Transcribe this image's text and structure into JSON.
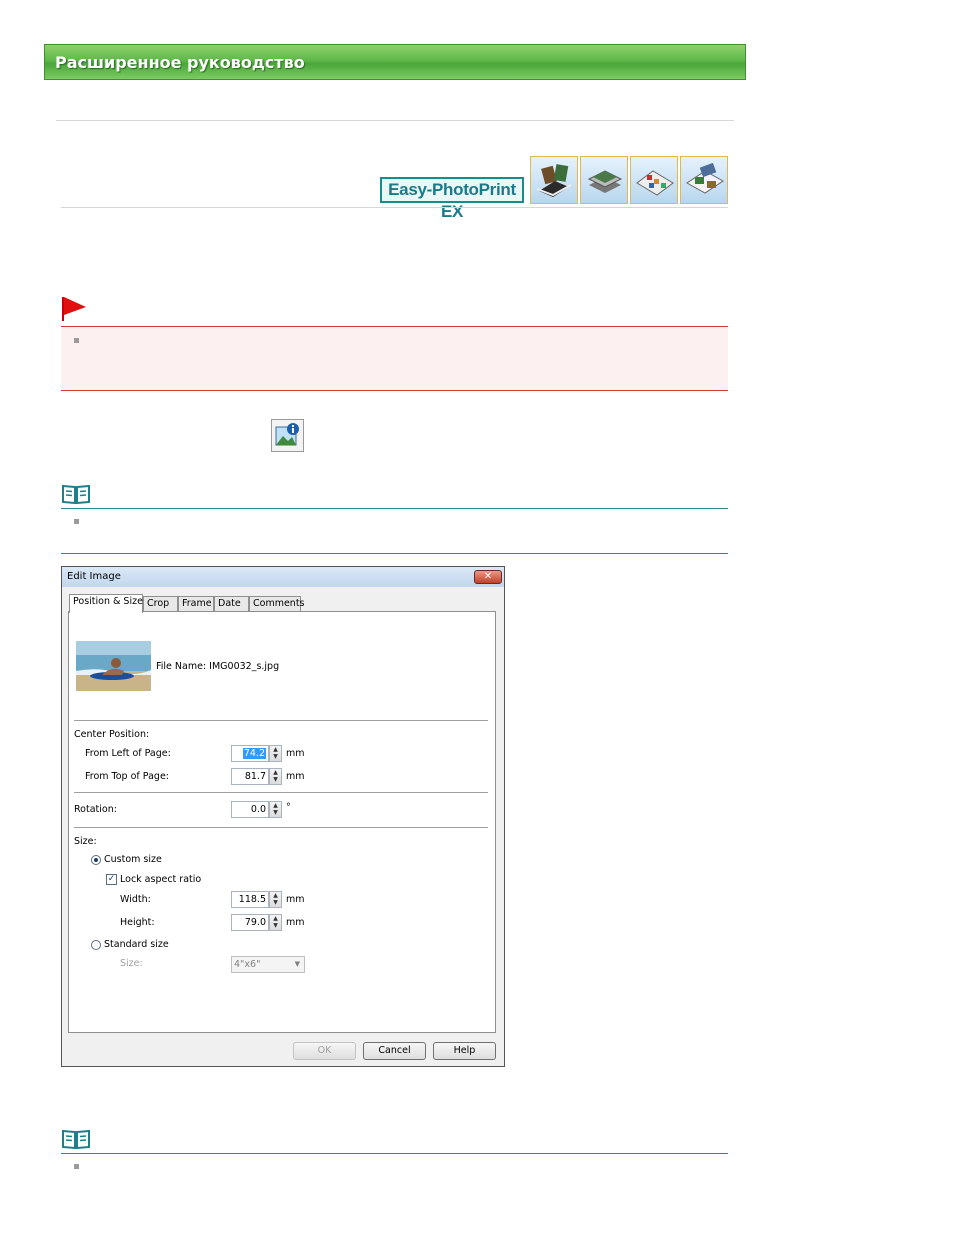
{
  "banner": {
    "title": "Расширенное руководство"
  },
  "logo": {
    "text": "Easy-PhotoPrint EX"
  },
  "dialog": {
    "title": "Edit Image",
    "close_glyph": "✕",
    "tabs": [
      {
        "label": "Position & Size",
        "active": true
      },
      {
        "label": "Crop"
      },
      {
        "label": "Frame"
      },
      {
        "label": "Date"
      },
      {
        "label": "Comments"
      }
    ],
    "file_name_label": "File Name: IMG0032_s.jpg",
    "center_position": {
      "heading": "Center Position:",
      "from_left_label": "From Left of Page:",
      "from_left_value": "74.2",
      "from_top_label": "From Top of Page:",
      "from_top_value": "81.7",
      "unit": "mm"
    },
    "rotation": {
      "label": "Rotation:",
      "value": "0.0",
      "unit": "°"
    },
    "size": {
      "heading": "Size:",
      "custom_size_label": "Custom size",
      "custom_selected": true,
      "lock_aspect_label": "Lock aspect ratio",
      "lock_aspect_checked": true,
      "width_label": "Width:",
      "width_value": "118.5",
      "height_label": "Height:",
      "height_value": "79.0",
      "unit": "mm",
      "standard_size_label": "Standard size",
      "standard_sub_label": "Size:",
      "standard_sub_value": "4\"x6\""
    },
    "buttons": {
      "ok": "OK",
      "cancel": "Cancel",
      "help": "Help"
    }
  }
}
